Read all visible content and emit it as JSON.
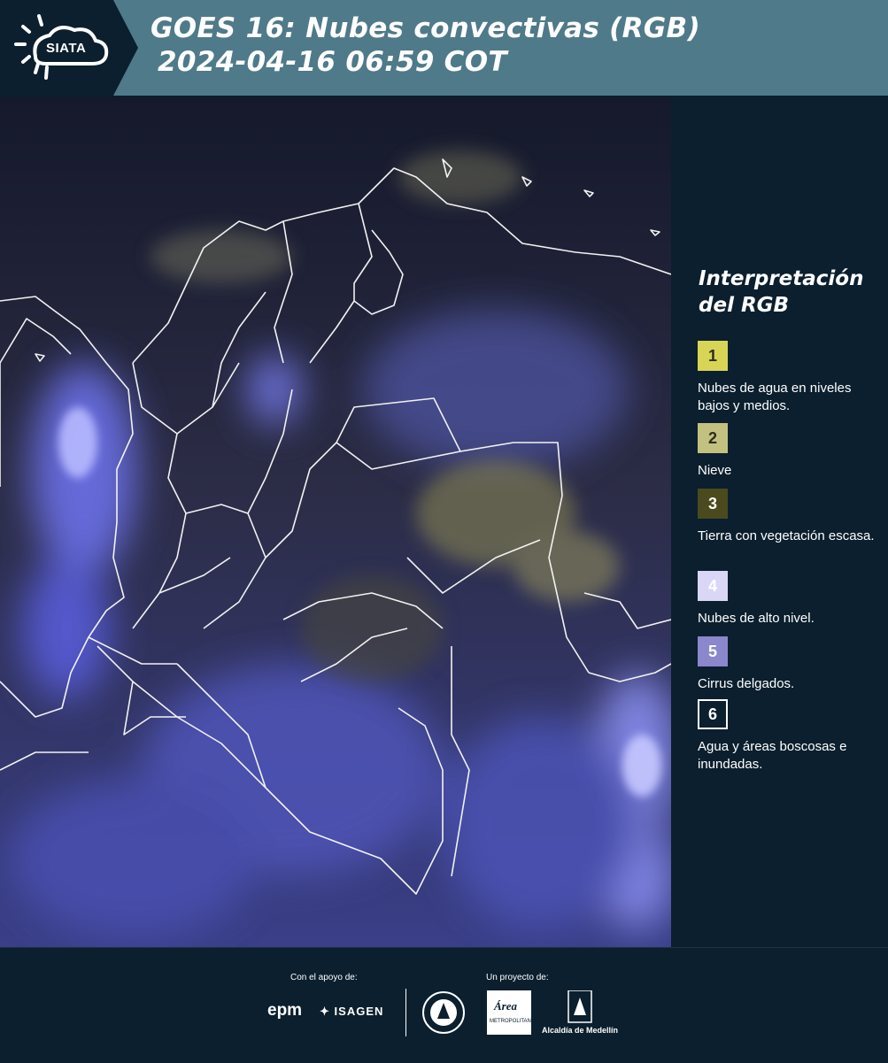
{
  "header": {
    "logo_text": "SIATA",
    "title_line1": "GOES 16: Nubes convectivas (RGB)",
    "title_line2": "2024-04-16 06:59 COT",
    "background_color": "#4f7a89",
    "logo_background_color": "#0b1f2e"
  },
  "map": {
    "description_icon": "satellite-rgb-image",
    "cloud_color": "#6e74e8",
    "ground_color": "#2a2a3e"
  },
  "legend": {
    "title": "Interpretación del RGB",
    "items": [
      {
        "number": "1",
        "label": "Nubes de agua en niveles bajos y medios.",
        "color": "#d8d556"
      },
      {
        "number": "2",
        "label": "Nieve",
        "color": "#c2c180"
      },
      {
        "number": "3",
        "label": "Tierra con vegetación escasa.",
        "color": "#4a4a1e"
      },
      {
        "number": "4",
        "label": "Nubes de alto nivel.",
        "color": "#d9d7f5"
      },
      {
        "number": "5",
        "label": "Cirrus delgados.",
        "color": "#8a87cc"
      },
      {
        "number": "6",
        "label": "Agua y áreas boscosas e inundadas.",
        "color": "#0b1f2e"
      }
    ]
  },
  "footer": {
    "support_caption": "Con el apoyo de:",
    "project_caption": "Un proyecto de:",
    "epm_logo_text": "epm",
    "isagen_logo_text": "ISAGEN",
    "area_logo_text": "Área",
    "area_logo_subtext": "METROPOLITANA",
    "alcaldia_text": "Alcaldía de Medellín"
  }
}
